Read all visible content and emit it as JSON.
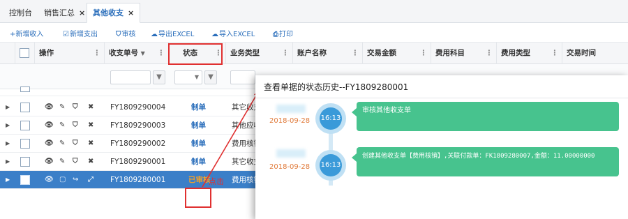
{
  "tabs": [
    {
      "label": "控制台",
      "closable": false,
      "active": false
    },
    {
      "label": "销售汇总",
      "closable": true,
      "active": false
    },
    {
      "label": "其他收支",
      "closable": true,
      "active": true
    }
  ],
  "tab_close_glyph": "×",
  "toolbar": {
    "add_income": "+新增收入",
    "add_expense": "新增支出",
    "review": "审核",
    "export_excel": "导出EXCEL",
    "import_excel": "导入EXCEL",
    "print": "打印"
  },
  "columns": {
    "operations": "操作",
    "doc_no": "收支单号",
    "doc_no_sort": "▼",
    "status": "状态",
    "biz_type": "业务类型",
    "account_name": "账户名称",
    "amount": "交易金额",
    "fee_subject": "费用科目",
    "fee_type": "费用类型",
    "trade_time": "交易时间"
  },
  "column_menu_glyph": "⋮",
  "filter_glyph": "▼",
  "rows": [
    {
      "doc_no": "FY1809290004",
      "status": "制单",
      "biz_type": "其它收支",
      "selected": false
    },
    {
      "doc_no": "FY1809290003",
      "status": "制单",
      "biz_type": "其他应收",
      "selected": false
    },
    {
      "doc_no": "FY1809290002",
      "status": "制单",
      "biz_type": "费用核销",
      "selected": false
    },
    {
      "doc_no": "FY1809290001",
      "status": "制单",
      "biz_type": "其它收支",
      "selected": false
    },
    {
      "doc_no": "FY1809280001",
      "status": "已审核",
      "biz_type": "费用核销",
      "selected": true
    }
  ],
  "row_actions": {
    "view": "👁",
    "edit": "✎",
    "shield": "⛉",
    "delete": "✖",
    "copy": "▢",
    "forward": "↪",
    "resize": "⤢"
  },
  "row_caret": "▶",
  "annotation": {
    "click_label": "点击"
  },
  "modal": {
    "title": "查看单据的状态历史--FY1809280001",
    "events": [
      {
        "date": "2018-09-28",
        "time": "16:13",
        "text": "审核其他收支单"
      },
      {
        "date": "2018-09-28",
        "time": "16:13",
        "text": "创建其他收支单【费用核销】,关联付款单：FK1809280007,金额：11.00000000"
      }
    ]
  },
  "colors": {
    "accent": "#2a6ebb",
    "selected_row": "#3b7fc8",
    "bubble": "#47c38e",
    "timeline_dot": "#3a9ad9",
    "annotation": "#e03030",
    "date": "#e07a3a"
  }
}
